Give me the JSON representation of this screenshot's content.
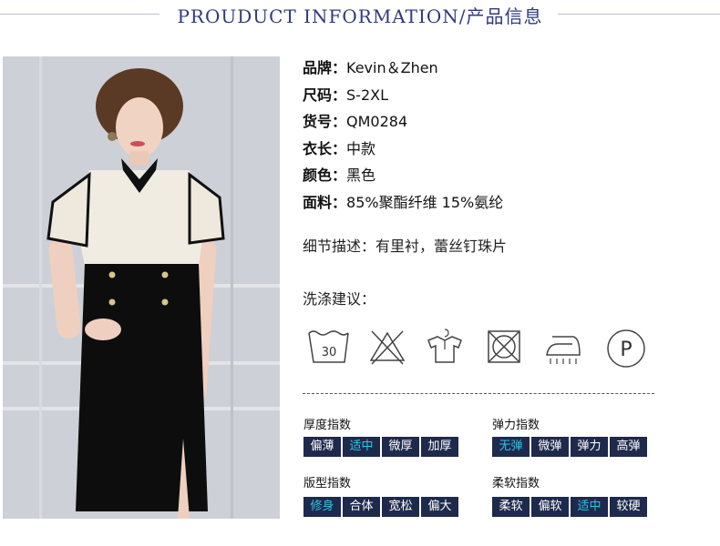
{
  "header": {
    "title": "PROUDUCT INFORMATION/产品信息"
  },
  "specs": [
    {
      "key": "品牌：",
      "value": "Kevin＆Zhen"
    },
    {
      "key": "尺码：",
      "value": "S-2XL"
    },
    {
      "key": "货号：",
      "value": "QM0284"
    },
    {
      "key": "衣长：",
      "value": "中款"
    },
    {
      "key": "颜色：",
      "value": "黑色"
    },
    {
      "key": "面料：",
      "value": "85%聚酯纤维 15%氨纶"
    }
  ],
  "detail": {
    "key": "细节描述：",
    "value": "有里衬，蕾丝钉珠片"
  },
  "wash": {
    "label": "洗涤建议：",
    "icons": [
      {
        "name": "wash-30-icon",
        "text": "30"
      },
      {
        "name": "no-bleach-icon"
      },
      {
        "name": "hang-dry-icon"
      },
      {
        "name": "no-tumble-dry-icon"
      },
      {
        "name": "iron-low-icon"
      },
      {
        "name": "dry-clean-p-icon",
        "text": "P"
      }
    ]
  },
  "indices": {
    "thickness": {
      "title": "厚度指数",
      "options": [
        "偏薄",
        "适中",
        "微厚",
        "加厚"
      ],
      "active": 1
    },
    "elasticity": {
      "title": "弹力指数",
      "options": [
        "无弹",
        "微弹",
        "弹力",
        "高弹"
      ],
      "active": 0
    },
    "fit": {
      "title": "版型指数",
      "options": [
        "修身",
        "合体",
        "宽松",
        "偏大"
      ],
      "active": 0
    },
    "softness": {
      "title": "柔软指数",
      "options": [
        "柔软",
        "偏软",
        "适中",
        "较硬"
      ],
      "active": 2
    }
  },
  "colors": {
    "accent": "#2ec4e6",
    "cell_bg": "#1e2a4c",
    "title": "#2e3a7e"
  }
}
